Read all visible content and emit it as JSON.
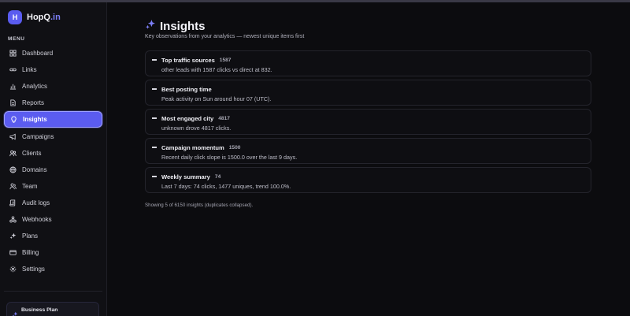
{
  "brand": {
    "logo_letter": "H",
    "name_main": "HopQ",
    "name_accent": ".in"
  },
  "sidebar": {
    "heading": "MENU",
    "items": [
      {
        "label": "Dashboard",
        "icon": "grid-icon"
      },
      {
        "label": "Links",
        "icon": "link-icon"
      },
      {
        "label": "Analytics",
        "icon": "bar-chart-icon"
      },
      {
        "label": "Reports",
        "icon": "document-icon"
      },
      {
        "label": "Insights",
        "icon": "lightbulb-icon",
        "active": true
      },
      {
        "label": "Campaigns",
        "icon": "megaphone-icon"
      },
      {
        "label": "Clients",
        "icon": "users-icon"
      },
      {
        "label": "Domains",
        "icon": "globe-icon"
      },
      {
        "label": "Team",
        "icon": "user-group-icon"
      },
      {
        "label": "Audit logs",
        "icon": "scroll-icon"
      },
      {
        "label": "Webhooks",
        "icon": "webhook-icon"
      },
      {
        "label": "Plans",
        "icon": "sparkles-icon"
      },
      {
        "label": "Billing",
        "icon": "credit-card-icon"
      },
      {
        "label": "Settings",
        "icon": "gear-icon"
      }
    ],
    "plan_label": "Business Plan"
  },
  "main": {
    "title": "Insights",
    "subtitle": "Key observations from your analytics — newest unique items first",
    "cards": [
      {
        "title": "Top traffic sources",
        "count": "1587",
        "body": "other leads with 1587 clicks vs direct at 832."
      },
      {
        "title": "Best posting time",
        "count": "",
        "body": "Peak activity on Sun around hour 07 (UTC)."
      },
      {
        "title": "Most engaged city",
        "count": "4817",
        "body": "unknown drove 4817 clicks."
      },
      {
        "title": "Campaign momentum",
        "count": "1500",
        "body": "Recent daily click slope is 1500.0 over the last 9 days."
      },
      {
        "title": "Weekly summary",
        "count": "74",
        "body": "Last 7 days: 74 clicks, 1477 uniques, trend 100.0%."
      }
    ],
    "footnote": "Showing 5 of 6150 insights (duplicates collapsed)."
  },
  "colors": {
    "accent": "#5b5cf0",
    "background": "#0c0c0f",
    "sidebar": "#101014"
  }
}
